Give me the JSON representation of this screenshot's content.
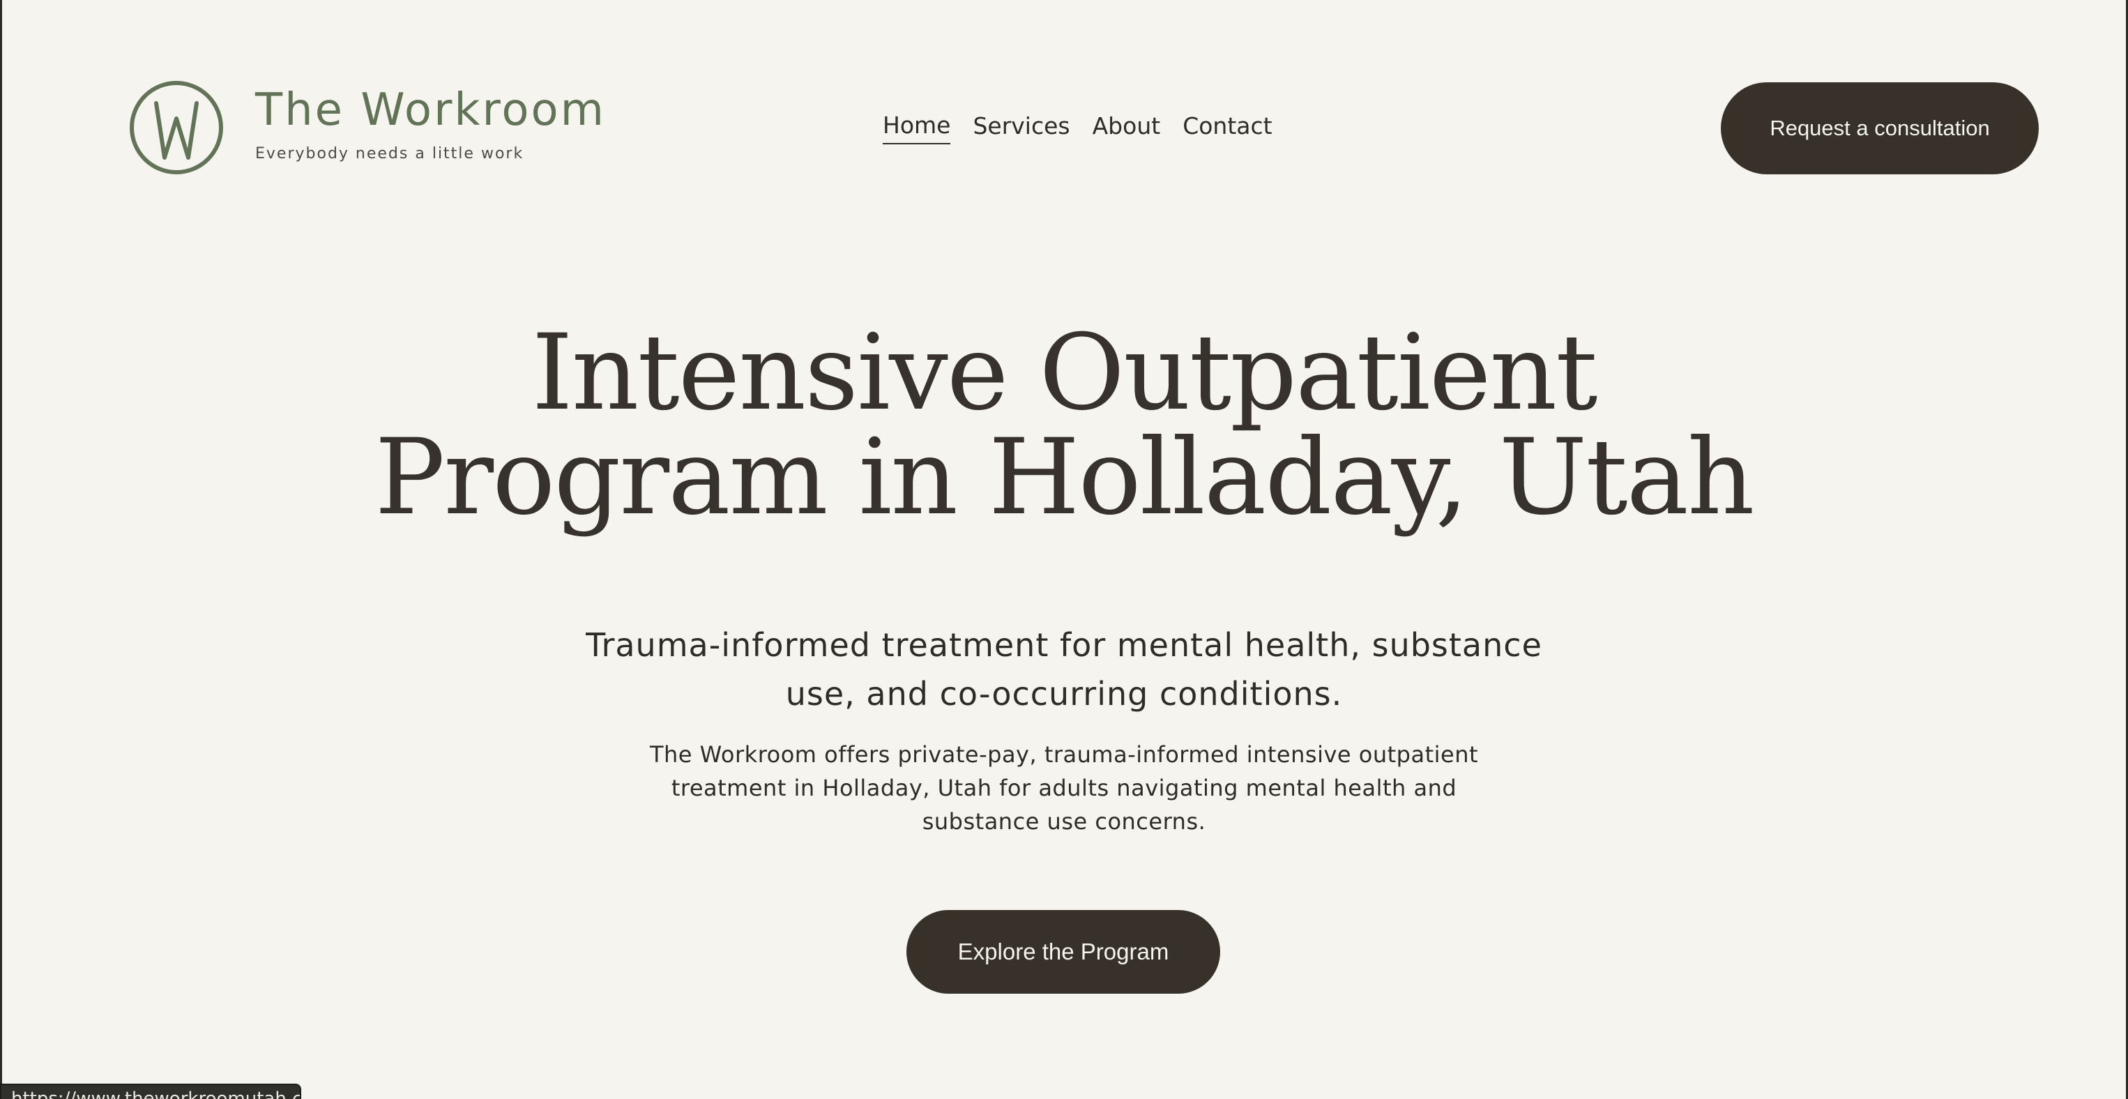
{
  "brand": {
    "name": "The Workroom",
    "tagline": "Everybody needs a little work",
    "logo_letter": "W",
    "color": "#637358"
  },
  "nav": {
    "items": [
      {
        "label": "Home",
        "active": true
      },
      {
        "label": "Services",
        "active": false
      },
      {
        "label": "About",
        "active": false
      },
      {
        "label": "Contact",
        "active": false
      }
    ]
  },
  "header": {
    "cta_label": "Request a consultation"
  },
  "hero": {
    "title_line1": "Intensive Outpatient",
    "title_line2": "Program in Holladay, Utah",
    "subtitle": "Trauma-informed treatment for mental health, substance use, and co-occurring conditions.",
    "body": "The Workroom offers private-pay, trauma-informed intensive outpatient treatment in Holladay, Utah for adults navigating mental health and substance use concerns.",
    "cta_label": "Explore the Program"
  },
  "status_bar": {
    "url": "https://www.theworkroomutah.com"
  },
  "colors": {
    "background": "#f5f4ef",
    "text": "#37322b",
    "button": "#37312a",
    "button_text": "#f5f4ef"
  }
}
